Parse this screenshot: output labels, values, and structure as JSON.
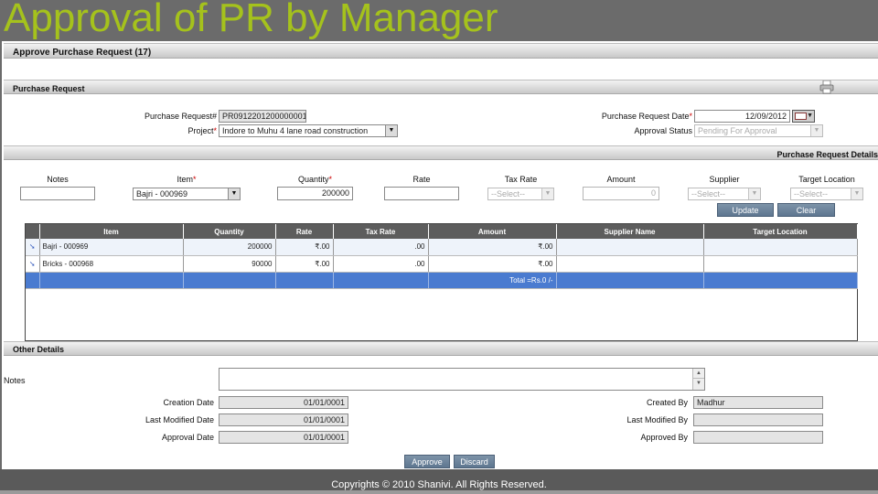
{
  "slide": {
    "title": "Approval of PR by Manager"
  },
  "header": {
    "title": "Approve Purchase Request (17)"
  },
  "purchase_request": {
    "section_title": "Purchase Request",
    "pr_no_label": "Purchase Request#",
    "pr_no_value": "PR0912201200000001",
    "project_label": "Project",
    "project_value": "Indore to Muhu 4 lane road construction",
    "date_label": "Purchase Request Date",
    "date_value": "12/09/2012",
    "status_label": "Approval Status",
    "status_value": "Pending For Approval",
    "required_mark": "*"
  },
  "details": {
    "section_title": "Purchase Request Details",
    "headers": {
      "notes": "Notes",
      "item": "Item",
      "quantity": "Quantity",
      "rate": "Rate",
      "tax_rate": "Tax Rate",
      "amount": "Amount",
      "supplier": "Supplier",
      "target_location": "Target Location"
    },
    "inputs": {
      "notes": "",
      "item": "Bajri - 000969",
      "quantity": "200000",
      "rate": "",
      "tax_rate": "--Select--",
      "amount": "0",
      "supplier": "--Select--",
      "target_location": "--Select--"
    },
    "update_label": "Update",
    "clear_label": "Clear"
  },
  "grid": {
    "columns": [
      "",
      "Item",
      "Quantity",
      "Rate",
      "Tax Rate",
      "Amount",
      "Supplier Name",
      "Target Location"
    ],
    "rows": [
      {
        "item": "Bajri - 000969",
        "quantity": "200000",
        "rate": "₹.00",
        "tax_rate": ".00",
        "amount": "₹.00",
        "supplier": "",
        "location": ""
      },
      {
        "item": "Bricks - 000968",
        "quantity": "90000",
        "rate": "₹.00",
        "tax_rate": ".00",
        "amount": "₹.00",
        "supplier": "",
        "location": ""
      }
    ],
    "total": "Total =Rs.0 /-"
  },
  "other": {
    "section_title": "Other Details",
    "notes_label": "Notes",
    "creation_date_label": "Creation Date",
    "creation_date": "01/01/0001",
    "last_modified_date_label": "Last Modified Date",
    "last_modified_date": "01/01/0001",
    "approval_date_label": "Approval Date",
    "approval_date": "01/01/0001",
    "created_by_label": "Created By",
    "created_by": "Madhur",
    "last_modified_by_label": "Last Modified By",
    "last_modified_by": "",
    "approved_by_label": "Approved By",
    "approved_by": ""
  },
  "actions": {
    "approve_label": "Approve",
    "discard_label": "Discard"
  },
  "footer": {
    "copyright": "Copyrights © 2010 Shanivi. All Rights Reserved."
  },
  "colors": {
    "title_green": "#a5c21c",
    "grid_header": "#5d5d5d",
    "total_row": "#4a7bd0",
    "button": "#6a829b"
  }
}
